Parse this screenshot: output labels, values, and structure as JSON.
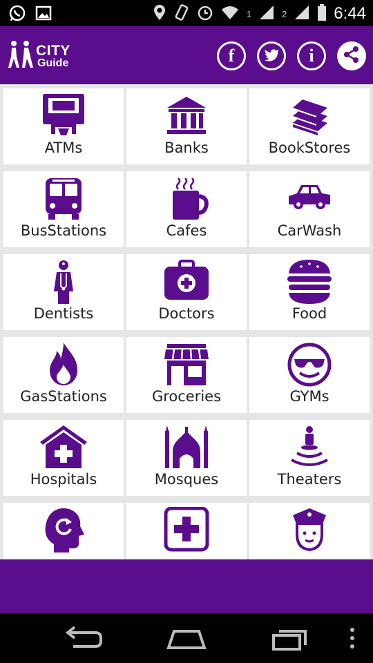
{
  "status_bar": {
    "time": "6:44",
    "sim1": "1",
    "sim2": "2",
    "icons": [
      "whatsapp-icon",
      "gallery-icon",
      "location-icon",
      "vibrate-icon",
      "alarm-icon",
      "wifi-icon",
      "signal-icon",
      "battery-icon"
    ]
  },
  "app": {
    "logo_city": "CITY",
    "logo_guide": "Guide",
    "brand_color": "#5a0d8c",
    "actions": {
      "facebook_label": "f",
      "info_label": "i"
    }
  },
  "categories": [
    {
      "label": "ATMs",
      "icon": "atm-icon"
    },
    {
      "label": "Banks",
      "icon": "bank-icon"
    },
    {
      "label": "BookStores",
      "icon": "books-icon"
    },
    {
      "label": "BusStations",
      "icon": "bus-icon"
    },
    {
      "label": "Cafes",
      "icon": "coffee-cup-icon"
    },
    {
      "label": "CarWash",
      "icon": "car-icon"
    },
    {
      "label": "Dentists",
      "icon": "doctor-person-icon"
    },
    {
      "label": "Doctors",
      "icon": "medical-kit-icon"
    },
    {
      "label": "Food",
      "icon": "burger-icon"
    },
    {
      "label": "GasStations",
      "icon": "flame-icon"
    },
    {
      "label": "Groceries",
      "icon": "store-icon"
    },
    {
      "label": "GYMs",
      "icon": "sunglasses-smiley-icon"
    },
    {
      "label": "Hospitals",
      "icon": "hospital-icon"
    },
    {
      "label": "Mosques",
      "icon": "mosque-icon"
    },
    {
      "label": "Theaters",
      "icon": "stage-icon"
    },
    {
      "label": "",
      "icon": "head-refresh-icon"
    },
    {
      "label": "",
      "icon": "pharmacy-cross-icon"
    },
    {
      "label": "",
      "icon": "police-icon"
    }
  ],
  "nav": {
    "icons": [
      "back-icon",
      "home-icon",
      "recents-icon",
      "menu-dots-icon"
    ]
  }
}
